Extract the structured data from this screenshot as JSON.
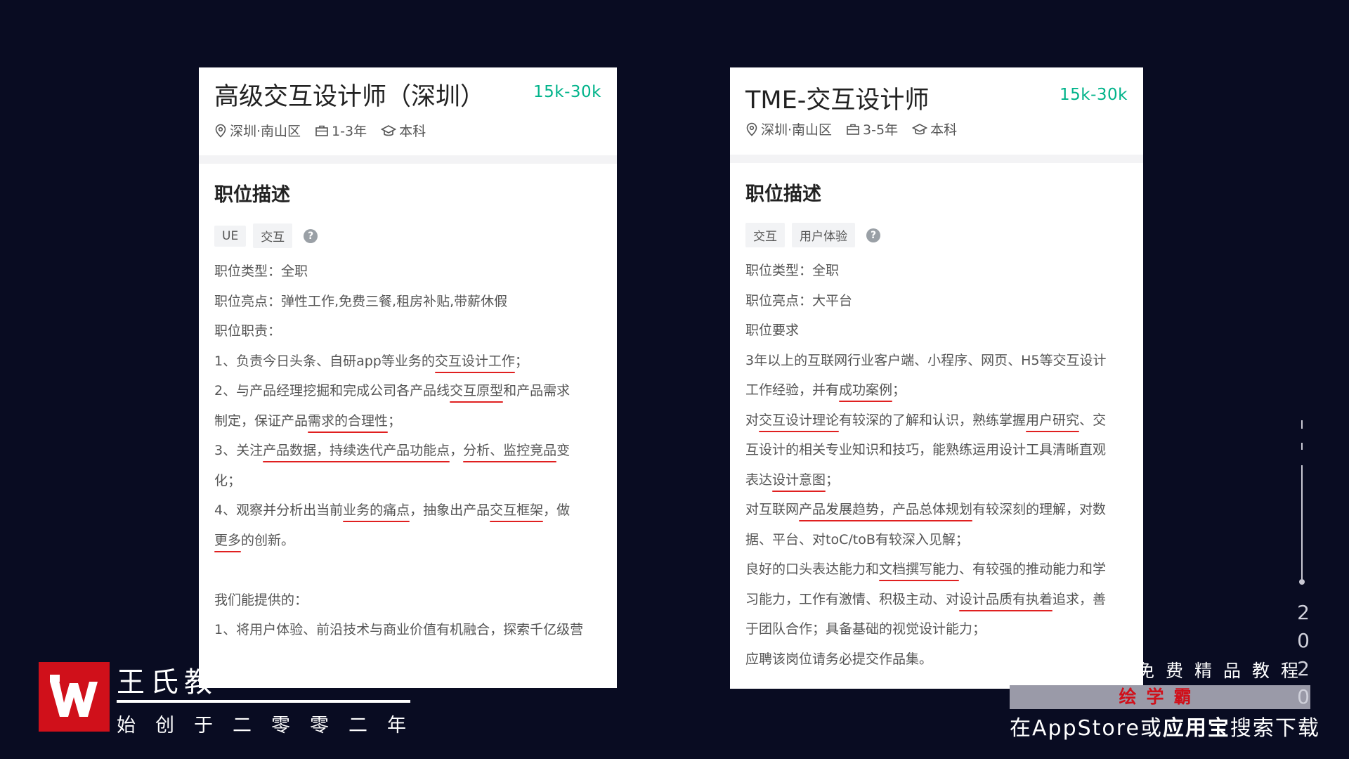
{
  "left_card": {
    "title": "高级交互设计师（深圳）",
    "salary": "15k-30k",
    "location": "深圳·南山区",
    "experience": "1-3年",
    "education": "本科",
    "section_title": "职位描述",
    "tags": [
      "UE",
      "交互"
    ],
    "help": "?",
    "lines": {
      "job_type": "职位类型：全职",
      "highlights": "职位亮点：弹性工作,免费三餐,租房补贴,带薪休假",
      "duties_label": "职位职责：",
      "d1": {
        "a": "1、负责今日头条、自研app等业务的",
        "b": "交互设计工作",
        "c": "；"
      },
      "d2a": {
        "a": "2、与产品经理挖掘和完成公司各产品线",
        "b": "交互原型",
        "c": "和产品需求"
      },
      "d2b": {
        "a": "制定，保证产品",
        "b": "需求的合理性",
        "c": "；"
      },
      "d3a": {
        "a": "3、关注",
        "b": "产品数据，持续迭代产品功能点",
        "c": "，",
        "d": "分析、监控竞品",
        "e": "变"
      },
      "d3b": "化；",
      "d4a": {
        "a": "4、观察并分析出当前",
        "b": "业务的痛点",
        "c": "，抽象出产品",
        "d": "交互框架",
        "e": "，做"
      },
      "d4b": {
        "a": "更多",
        "b": "的创新。"
      },
      "offer_label": "我们能提供的：",
      "o1": "1、将用户体验、前沿技术与商业价值有机融合，探索千亿级营"
    }
  },
  "right_card": {
    "title": "TME-交互设计师",
    "salary": "15k-30k",
    "location": "深圳·南山区",
    "experience": "3-5年",
    "education": "本科",
    "section_title": "职位描述",
    "tags": [
      "交互",
      "用户体验"
    ],
    "help": "?",
    "lines": {
      "job_type": "职位类型：全职",
      "highlights": "职位亮点：大平台",
      "req_label": "职位要求",
      "r1a": "3年以上的互联网行业客户端、小程序、网页、H5等交互设计",
      "r1b": {
        "a": "工作经验，并有",
        "b": "成功案例",
        "c": "；"
      },
      "r2a": {
        "a": "对",
        "b": "交互设计理论",
        "c": "有较深的了解和认识，熟练掌握",
        "d": "用户研究",
        "e": "、交"
      },
      "r2b": "互设计的相关专业知识和技巧，能熟练运用设计工具清晰直观",
      "r2c": {
        "a": "表达",
        "b": "设计意图",
        "c": "；"
      },
      "r3a": {
        "a": "对互联网",
        "b": "产品发展趋势，产品总体规划",
        "c": "有较深刻的理解，对数"
      },
      "r3b": "据、平台、对toC/toB有较深入见解；",
      "r4a": {
        "a": "良好的口头表达能力和",
        "b": "文档撰写能力",
        "c": "、有较强的推动能力和学"
      },
      "r4b": {
        "a": "习能力，工作有激情、积极主动、对",
        "b": "设计品质有执着",
        "c": "追求，善"
      },
      "r4c": "于团队合作；具备基础的视觉设计能力；",
      "r5": "应聘该岗位请务必提交作品集。"
    }
  },
  "overlay": {
    "brand_name": "王氏教",
    "brand_sub": "始创于二零零二年",
    "ad_line1": "免费精品教程",
    "ad_line2": "绘学霸",
    "ad_line3_a": "在AppStore或",
    "ad_line3_b": "应用宝",
    "ad_line3_c": "搜索下载",
    "year_digits": [
      "2",
      "0",
      "2",
      "0"
    ],
    "accent_red": "#d0101a",
    "salary_green": "#00b38a"
  }
}
